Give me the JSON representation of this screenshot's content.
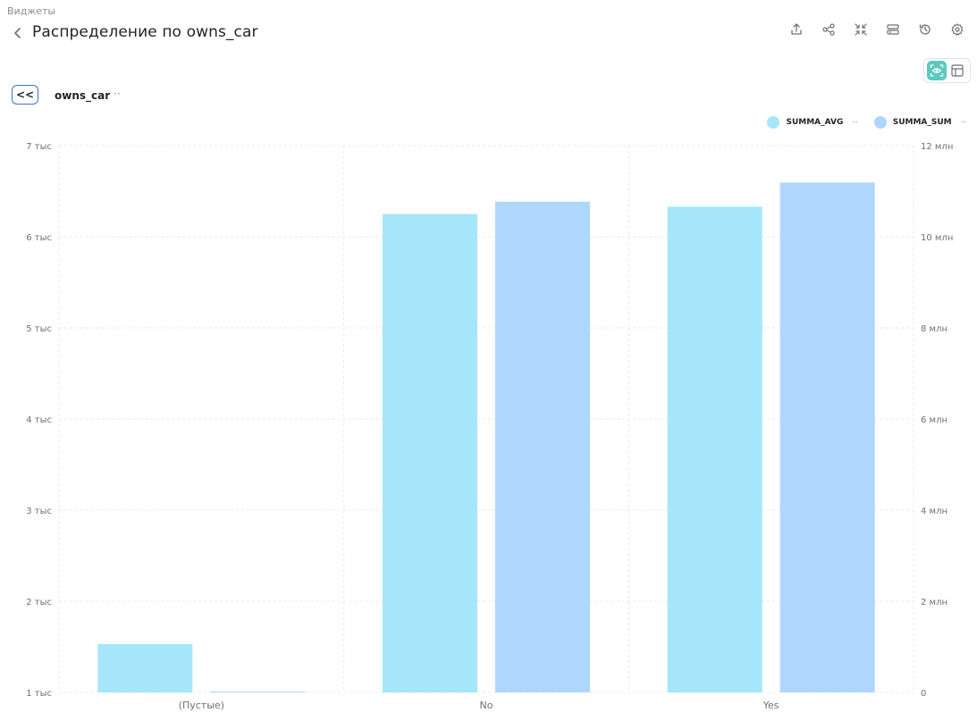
{
  "header": {
    "breadcrumb": "Виджеты",
    "title": "Распределение по owns_car"
  },
  "toolbar": {
    "icons": [
      "export-icon",
      "share-icon",
      "collapse-icon",
      "filter-panel-icon",
      "history-icon",
      "gear-icon"
    ]
  },
  "view_toggle": {
    "icons": [
      "preview-icon",
      "layout-icon"
    ],
    "active": "preview-icon"
  },
  "drill": {
    "back_label": "<<",
    "dimension": "owns_car",
    "more": "··"
  },
  "legend": {
    "more": "··"
  },
  "colors": {
    "summa_avg": "#a6e6fb",
    "summa_sum": "#afd6fd",
    "accent": "#5cc9c0",
    "drill_border": "#3a74c8"
  },
  "chart_data": {
    "type": "bar",
    "categories": [
      "(Пустые)",
      "No",
      "Yes"
    ],
    "series": [
      {
        "name": "SUMMA_AVG",
        "axis": "left",
        "values": [
          1530,
          6250,
          6330
        ]
      },
      {
        "name": "SUMMA_SUM",
        "axis": "right",
        "values": [
          20000,
          10770000,
          11190000
        ]
      }
    ],
    "y_left": {
      "min": 1000,
      "max": 7000,
      "ticks": [
        1000,
        2000,
        3000,
        4000,
        5000,
        6000,
        7000
      ],
      "tick_labels": [
        "1 тыс",
        "2 тыс",
        "3 тыс",
        "4 тыс",
        "5 тыс",
        "6 тыс",
        "7 тыс"
      ]
    },
    "y_right": {
      "min": 0,
      "max": 12000000,
      "ticks": [
        0,
        2000000,
        4000000,
        6000000,
        8000000,
        10000000,
        12000000
      ],
      "tick_labels": [
        "0",
        "2 млн",
        "4 млн",
        "6 млн",
        "8 млн",
        "10 млн",
        "12 млн"
      ]
    },
    "grid": true,
    "legend_position": "top-right"
  }
}
